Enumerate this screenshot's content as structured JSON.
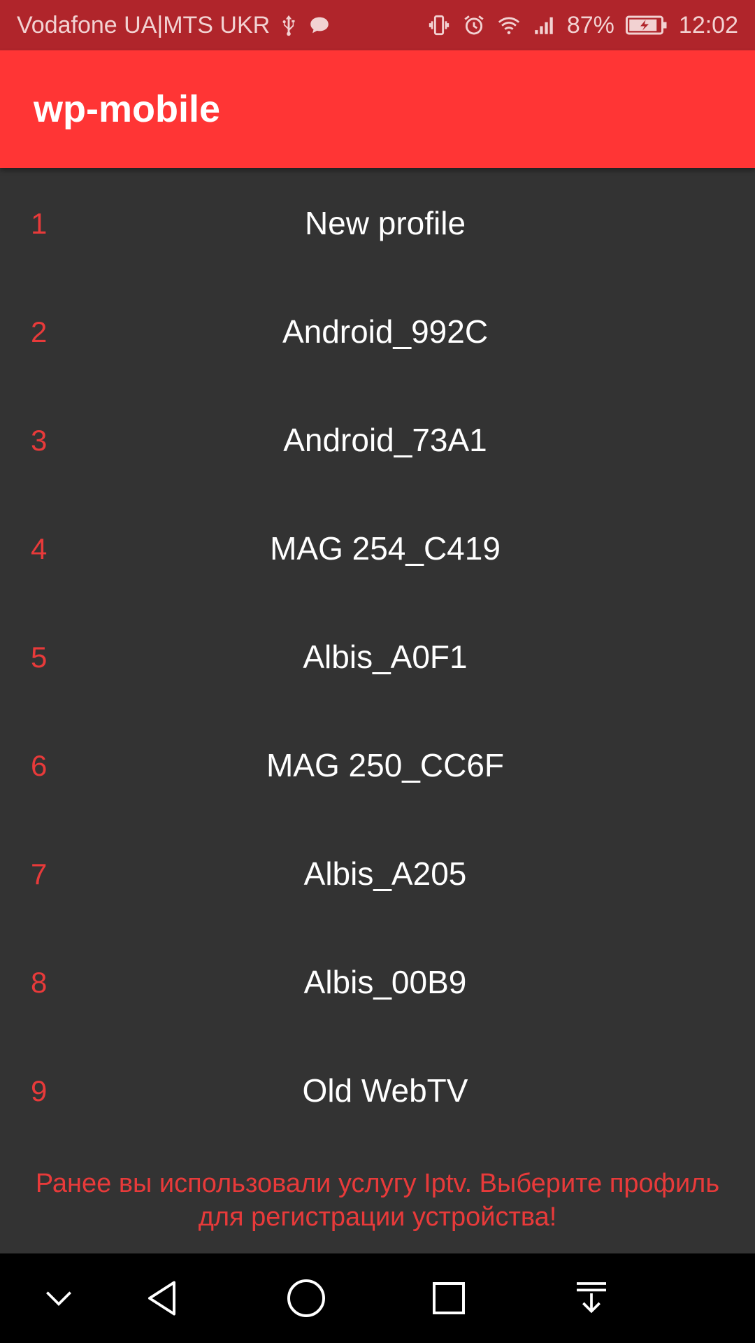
{
  "status_bar": {
    "carrier": "Vodafone UA|MTS UKR",
    "battery": "87%",
    "time": "12:02",
    "icons": [
      "usb-icon",
      "message-icon",
      "vibrate-icon",
      "alarm-icon",
      "wifi-icon",
      "signal-icon",
      "battery-charging-icon"
    ]
  },
  "app_bar": {
    "title": "wp-mobile",
    "color": "#ff3535"
  },
  "profiles": [
    {
      "number": "1",
      "name": "New profile"
    },
    {
      "number": "2",
      "name": "Android_992C"
    },
    {
      "number": "3",
      "name": "Android_73A1"
    },
    {
      "number": "4",
      "name": "MAG 254_C419"
    },
    {
      "number": "5",
      "name": "Albis_A0F1"
    },
    {
      "number": "6",
      "name": "MAG 250_CC6F"
    },
    {
      "number": "7",
      "name": "Albis_A205"
    },
    {
      "number": "8",
      "name": "Albis_00B9"
    },
    {
      "number": "9",
      "name": "Old WebTV"
    }
  ],
  "notice": "Ранее вы использовали услугу Iptv. Выберите профиль для регистрации устройства!",
  "nav_bar": {
    "icons": [
      "hide-keyboard-icon",
      "back-icon",
      "home-icon",
      "recents-icon",
      "notification-pull-icon"
    ]
  }
}
